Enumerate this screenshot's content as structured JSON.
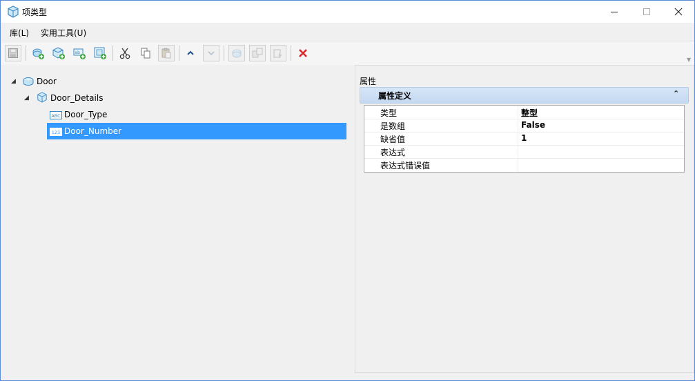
{
  "window": {
    "title": "项类型",
    "controls": {
      "minimize_icon": "minimize-icon",
      "maximize_icon": "maximize-icon",
      "close_icon": "close-icon"
    }
  },
  "menu": {
    "items": [
      {
        "label": "库(L)"
      },
      {
        "label": "实用工具(U)"
      }
    ]
  },
  "toolbar": {
    "buttons": [
      {
        "name": "save-button",
        "icon": "save-icon",
        "enabled": false
      },
      {
        "name": "new-item-type-button",
        "icon": "add-item-type-icon",
        "enabled": true
      },
      {
        "name": "new-item-button",
        "icon": "add-item-icon",
        "enabled": true
      },
      {
        "name": "new-property-button",
        "icon": "add-property-icon",
        "enabled": true
      },
      {
        "name": "add-from-template-button",
        "icon": "add-template-icon",
        "enabled": true
      },
      {
        "name": "cut-button",
        "icon": "scissors-icon",
        "enabled": true
      },
      {
        "name": "copy-button",
        "icon": "copy-icon",
        "enabled": true
      },
      {
        "name": "paste-button",
        "icon": "paste-icon",
        "enabled": false
      },
      {
        "name": "move-up-button",
        "icon": "chevron-up-icon",
        "enabled": true
      },
      {
        "name": "move-down-button",
        "icon": "chevron-down-icon",
        "enabled": false
      },
      {
        "name": "import-button",
        "icon": "import-icon",
        "enabled": false
      },
      {
        "name": "export-button",
        "icon": "export-icon",
        "enabled": false
      },
      {
        "name": "duplicate-button",
        "icon": "duplicate-icon",
        "enabled": false
      },
      {
        "name": "delete-button",
        "icon": "delete-x-icon",
        "enabled": true
      }
    ]
  },
  "tree": {
    "nodes": [
      {
        "label": "Door",
        "icon": "library-icon",
        "expanded": true
      },
      {
        "label": "Door_Details",
        "icon": "item-type-cube-icon",
        "expanded": true
      },
      {
        "label": "Door_Type",
        "icon": "text-property-icon",
        "icon_text": "ABC"
      },
      {
        "label": "Door_Number",
        "icon": "number-property-icon",
        "icon_text": "123",
        "selected": true
      }
    ]
  },
  "properties": {
    "legend": "属性",
    "category": "属性定义",
    "rows": [
      {
        "name": "类型",
        "value": "整型"
      },
      {
        "name": "是数组",
        "value": "False"
      },
      {
        "name": "缺省值",
        "value": "1"
      },
      {
        "name": "表达式",
        "value": ""
      },
      {
        "name": "表达式错误值",
        "value": ""
      }
    ]
  },
  "colors": {
    "selection": "#3399ff",
    "category_bar": "#cfe0f4",
    "delete": "#d9262c",
    "window_border": "#5a8bd6"
  }
}
